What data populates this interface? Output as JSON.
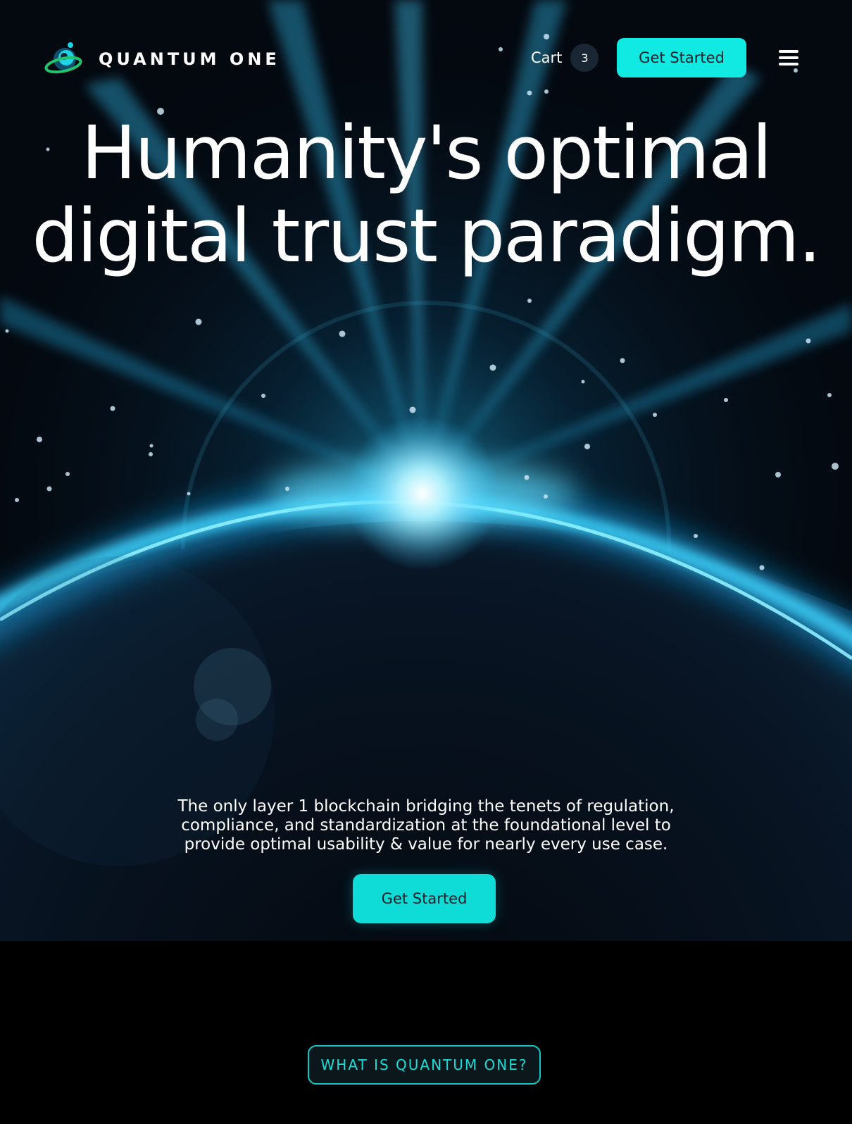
{
  "brand": {
    "name": "QUANTUM ONE",
    "logo_icon": "orbit-logo-icon"
  },
  "header": {
    "cart_label": "Cart",
    "cart_count": "3",
    "cta_label": "Get Started",
    "menu_icon": "hamburger-menu-icon"
  },
  "hero": {
    "headline_line1": "Humanity's optimal",
    "headline_line2": "digital trust paradigm.",
    "subcopy_line1": "The only layer 1 blockchain bridging the tenets of regulation,",
    "subcopy_line2": "compliance, and standardization at the foundational level to",
    "subcopy_line3": "provide optimal usability & value for nearly every use case.",
    "cta_label": "Get Started",
    "background_image": "planet-horizon-sunrise-space"
  },
  "section": {
    "pill_label": "WHAT IS QUANTUM ONE?"
  },
  "colors": {
    "accent": "#10eae3",
    "background": "#000000",
    "hero_dark": "#04080f",
    "glow": "#1ecbff"
  }
}
